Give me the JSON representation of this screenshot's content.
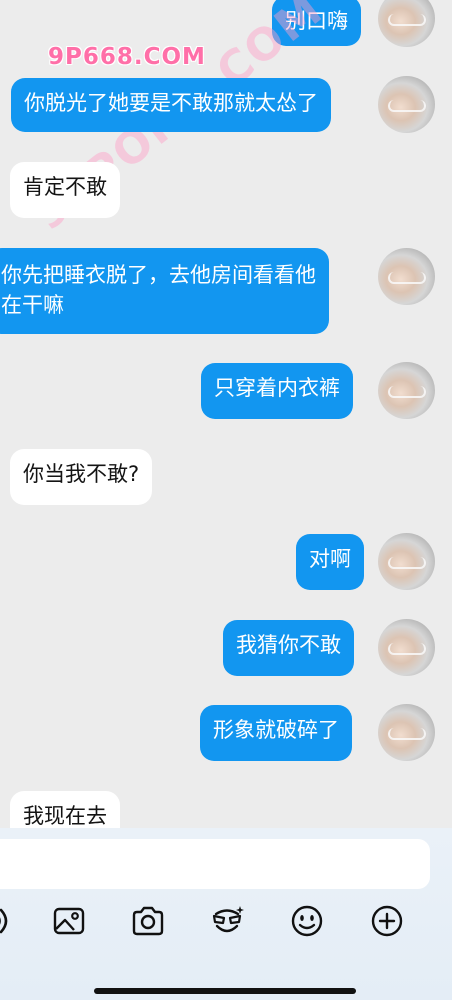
{
  "watermark": {
    "site": "9P668.COM",
    "diagonal": "91PORN.COM"
  },
  "messages": [
    {
      "side": "out",
      "text": "别口嗨"
    },
    {
      "side": "out",
      "text": "你脱光了她要是不敢那就太怂了"
    },
    {
      "side": "in",
      "text": "肯定不敢"
    },
    {
      "side": "out",
      "text": "你先把睡衣脱了，去他房间看看他",
      "text2": "在干嘛"
    },
    {
      "side": "out",
      "text": "只穿着内衣裤"
    },
    {
      "side": "in",
      "text": "你当我不敢?"
    },
    {
      "side": "out",
      "text": "对啊"
    },
    {
      "side": "out",
      "text": "我猜你不敢"
    },
    {
      "side": "out",
      "text": "形象就破碎了"
    },
    {
      "side": "in",
      "text": "我现在去"
    }
  ],
  "composer": {
    "input_value": "",
    "tools": [
      "voice-icon",
      "image-icon",
      "camera-icon",
      "sticker-icon",
      "emoji-icon",
      "add-icon"
    ]
  }
}
